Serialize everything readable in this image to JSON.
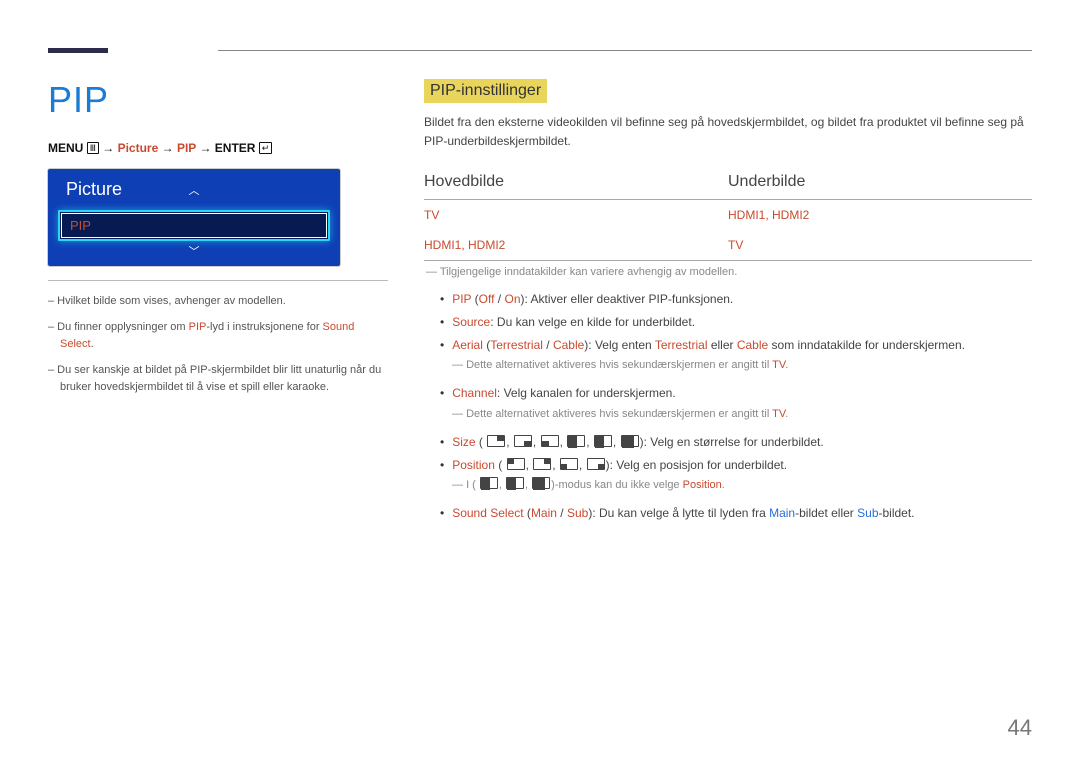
{
  "page": {
    "title": "PIP",
    "number": "44"
  },
  "breadcrumb": {
    "menu": "MENU",
    "arrow": "→",
    "picture": "Picture",
    "pip": "PIP",
    "enter": "ENTER"
  },
  "osd": {
    "title": "Picture",
    "item": "PIP"
  },
  "footnotes": [
    {
      "pre": "– ",
      "parts": [
        {
          "t": "Hvilket bilde som vises, avhenger av modellen."
        }
      ]
    },
    {
      "pre": "– ",
      "parts": [
        {
          "t": "Du finner opplysninger om "
        },
        {
          "t": "PIP",
          "hl": true
        },
        {
          "t": "-lyd i instruksjonene for "
        },
        {
          "t": "Sound Select",
          "hl": true
        },
        {
          "t": "."
        }
      ]
    },
    {
      "pre": "– ",
      "parts": [
        {
          "t": "Du ser kanskje at bildet på PIP-skjermbildet blir litt unaturlig når du bruker hovedskjermbildet til å vise et spill eller karaoke."
        }
      ]
    }
  ],
  "section": {
    "heading": "PIP-innstillinger",
    "intro": "Bildet fra den eksterne videokilden vil befinne seg på hovedskjermbildet, og bildet fra produktet vil befinne seg på PIP-underbildeskjermbildet."
  },
  "table": {
    "col1": "Hovedbilde",
    "col2": "Underbilde",
    "r1c1": "TV",
    "r1c2": "HDMI1, HDMI2",
    "r2c1": "HDMI1, HDMI2",
    "r2c2": "TV"
  },
  "belowTableNote": "Tilgjengelige inndatakilder kan variere avhengig av modellen.",
  "bullets": {
    "pip": {
      "k": "PIP",
      "opts": [
        "Off",
        "On"
      ],
      "tail": ": Aktiver eller deaktiver PIP-funksjonen."
    },
    "source": {
      "k": "Source",
      "tail": ": Du kan velge en kilde for underbildet."
    },
    "aerial": {
      "k": "Aerial",
      "opts": [
        "Terrestrial",
        "Cable"
      ],
      "mid1": ": Velg enten ",
      "mid2": " eller ",
      "tail": " som inndatakilde for underskjermen."
    },
    "aerialNote": {
      "pre": "Dette alternativet aktiveres hvis sekundærskjermen er angitt til ",
      "hl": "TV",
      "post": "."
    },
    "channel": {
      "k": "Channel",
      "tail": ": Velg kanalen for underskjermen."
    },
    "channelNote": {
      "pre": "Dette alternativet aktiveres hvis sekundærskjermen er angitt til ",
      "hl": "TV",
      "post": "."
    },
    "size": {
      "k": "Size",
      "tail": "): Velg en størrelse for underbildet."
    },
    "position": {
      "k": "Position",
      "tail": "): Velg en posisjon for underbildet."
    },
    "positionNote": {
      "pre": "I (",
      "mid": ")-modus kan du ikke velge ",
      "hl": "Position",
      "post": "."
    },
    "sound": {
      "k": "Sound Select",
      "opts": [
        "Main",
        "Sub"
      ],
      "mid": ": Du kan velge å lytte til lyden fra ",
      "m1": "Main",
      "m2": "-bildet eller ",
      "m3": "Sub",
      "tail": "-bildet."
    }
  }
}
